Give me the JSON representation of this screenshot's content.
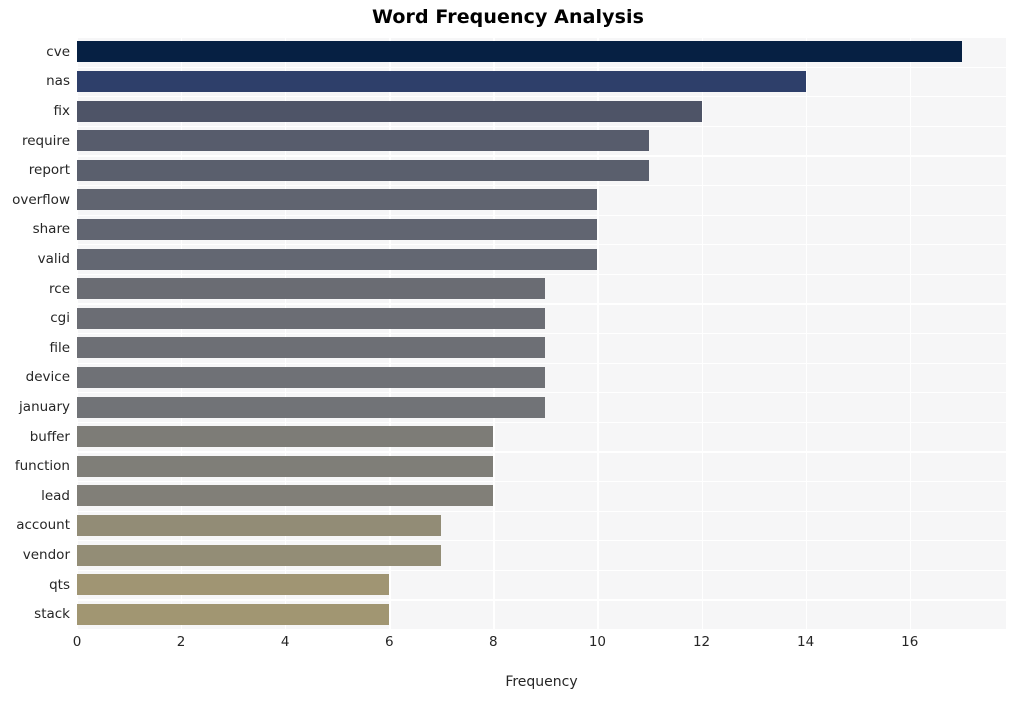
{
  "chart_data": {
    "type": "bar",
    "orientation": "horizontal",
    "title": "Word Frequency Analysis",
    "xlabel": "Frequency",
    "ylabel": "",
    "categories": [
      "cve",
      "nas",
      "fix",
      "require",
      "report",
      "overflow",
      "share",
      "valid",
      "rce",
      "cgi",
      "file",
      "device",
      "january",
      "buffer",
      "function",
      "lead",
      "account",
      "vendor",
      "qts",
      "stack"
    ],
    "values": [
      17,
      14,
      12,
      11,
      11,
      10,
      10,
      10,
      9,
      9,
      9,
      9,
      9,
      8,
      8,
      8,
      7,
      7,
      6,
      6
    ],
    "xticks": [
      0,
      2,
      4,
      6,
      8,
      10,
      12,
      14,
      16
    ],
    "xlim": [
      0,
      17.85
    ],
    "grid": true,
    "legend": false,
    "bar_colors": [
      "#062043",
      "#2e3f6a",
      "#4e5467",
      "#575c6c",
      "#5a5f6d",
      "#606470",
      "#616571",
      "#636772",
      "#6a6c73",
      "#6b6d74",
      "#6d6f75",
      "#6f7176",
      "#717377",
      "#7d7c77",
      "#7f7e78",
      "#817f78",
      "#928c76",
      "#938d76",
      "#a09573",
      "#a19672"
    ],
    "plot_background": "#f6f6f7",
    "grid_color": "#ffffff",
    "text_color": "#262626"
  }
}
